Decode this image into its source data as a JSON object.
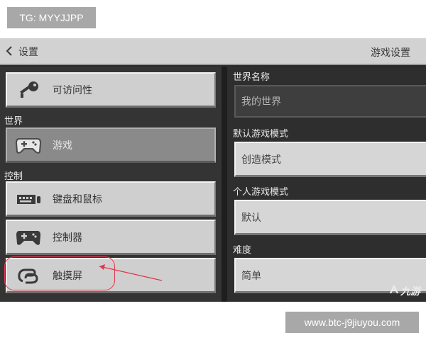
{
  "watermark_top": "TG: MYYJJPP",
  "watermark_bottom": "www.btc-j9jiuyou.com",
  "header": {
    "back_label": "设置",
    "title": "游戏设置",
    "back_icon": "chevron-left-icon"
  },
  "sidebar": {
    "accessibility": {
      "label": "可访问性",
      "icon": "key-icon"
    },
    "section_world": "世界",
    "game": {
      "label": "游戏",
      "icon": "gamepad-icon",
      "selected": true
    },
    "section_controls": "控制",
    "keyboard_mouse": {
      "label": "键盘和鼠标",
      "icon": "keyboard-icon"
    },
    "controller": {
      "label": "控制器",
      "icon": "gamepad-icon"
    },
    "touch": {
      "label": "触摸屏",
      "icon": "touch-hand-icon"
    }
  },
  "settings": {
    "world_name": {
      "label": "世界名称",
      "value": "我的世界"
    },
    "default_game_mode": {
      "label": "默认游戏模式",
      "value": "创造模式"
    },
    "personal_game_mode": {
      "label": "个人游戏模式",
      "value": "默认"
    },
    "difficulty": {
      "label": "难度",
      "value": "简单"
    }
  },
  "annotation": {
    "color": "#e0384a"
  },
  "logo_text": "九游"
}
